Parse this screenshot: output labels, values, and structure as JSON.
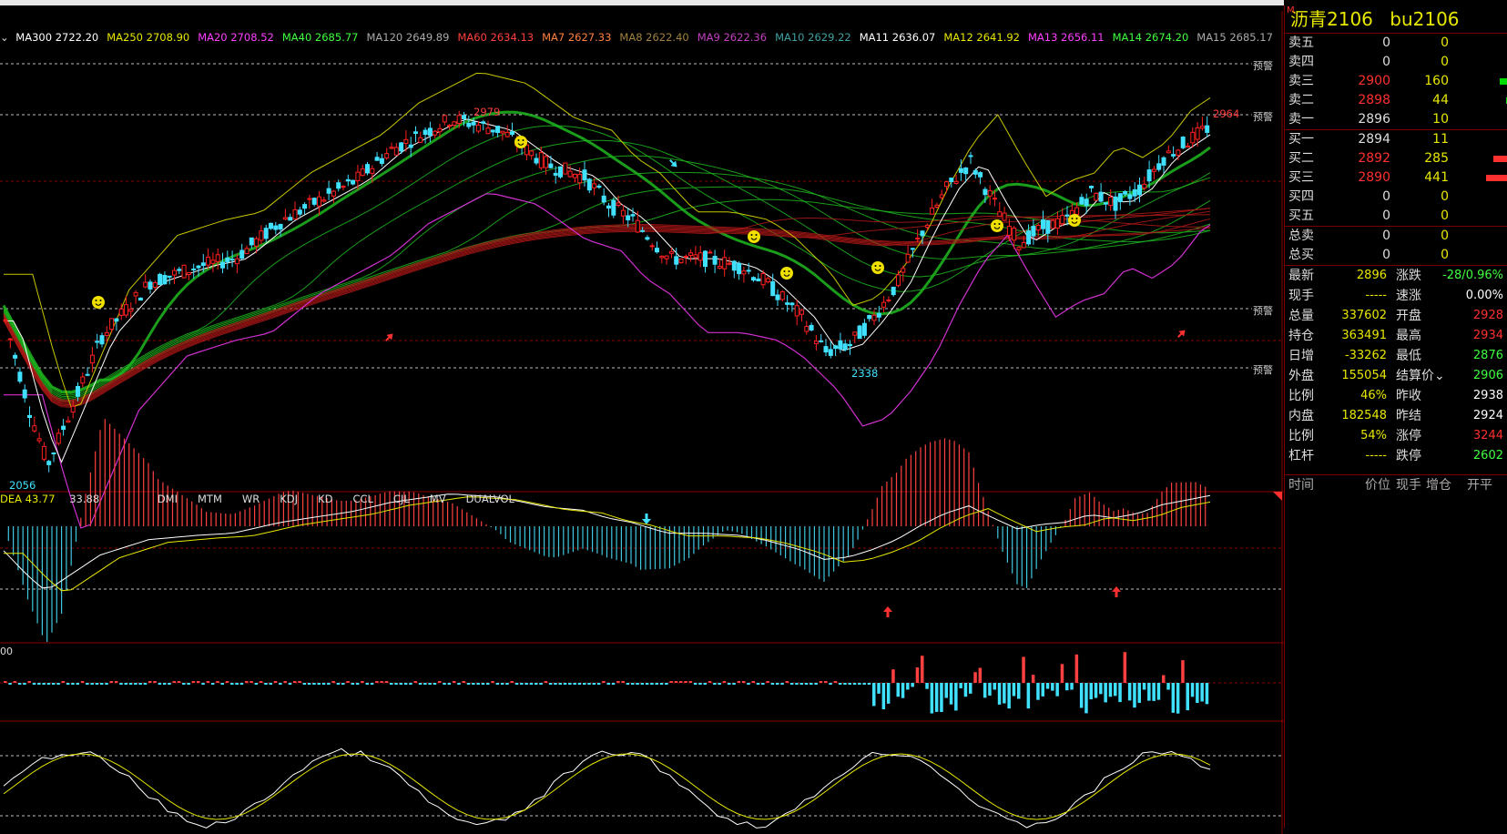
{
  "ma_bar": {
    "prefix": "⌄",
    "items": [
      {
        "label": "MA300 2722.20",
        "color": "#ffffff"
      },
      {
        "label": "MA250 2708.90",
        "color": "#e7e700"
      },
      {
        "label": "MA20 2708.52",
        "color": "#ff40ff"
      },
      {
        "label": "MA40 2685.77",
        "color": "#40ff40"
      },
      {
        "label": "MA120 2649.89",
        "color": "#aaaaaa"
      },
      {
        "label": "MA60 2634.13",
        "color": "#ff4040"
      },
      {
        "label": "MA7 2627.33",
        "color": "#ff8040"
      },
      {
        "label": "MA8 2622.40",
        "color": "#a08040"
      },
      {
        "label": "MA9 2622.36",
        "color": "#c040c0"
      },
      {
        "label": "MA10 2629.22",
        "color": "#40a0a0"
      },
      {
        "label": "MA11 2636.07",
        "color": "#ffffff"
      },
      {
        "label": "MA12 2641.92",
        "color": "#e7e700"
      },
      {
        "label": "MA13 2656.11",
        "color": "#ff40ff"
      },
      {
        "label": "MA14 2674.20",
        "color": "#40ff40"
      },
      {
        "label": "MA15 2685.17",
        "color": "#aaaaaa"
      }
    ]
  },
  "main_chart": {
    "high_label": "2979",
    "recent_high_label": "2964",
    "low_label": "2338",
    "bottom_label": "2056",
    "warn_label": "预警"
  },
  "indicator": {
    "dea_label": "DEA 43.77",
    "dea_value": "33.88",
    "tabs": [
      "DMI",
      "MTM",
      "WR",
      "KDJ",
      "KD",
      "CCL",
      "CJL",
      "MV",
      "DUALVOL"
    ],
    "vol_axis": "00"
  },
  "quote": {
    "title": "沥青2106",
    "code": "bu2106",
    "mark": "M",
    "sells": [
      {
        "name": "卖五",
        "price": "0",
        "vol": "0",
        "price_color": "#dddddd",
        "bar": 0
      },
      {
        "name": "卖四",
        "price": "0",
        "vol": "0",
        "price_color": "#dddddd",
        "bar": 0
      },
      {
        "name": "卖三",
        "price": "2900",
        "vol": "160",
        "price_color": "#ff3030",
        "bar": 160,
        "bar_color": "#00dd00"
      },
      {
        "name": "卖二",
        "price": "2898",
        "vol": "44",
        "price_color": "#ff3030",
        "bar": 44,
        "bar_color": "#00dd00"
      },
      {
        "name": "卖一",
        "price": "2896",
        "vol": "10",
        "price_color": "#dddddd",
        "bar": 0
      }
    ],
    "buys": [
      {
        "name": "买一",
        "price": "2894",
        "vol": "11",
        "price_color": "#dddddd",
        "bar": 0
      },
      {
        "name": "买二",
        "price": "2892",
        "vol": "285",
        "price_color": "#ff3030",
        "bar": 285,
        "bar_color": "#ff3030"
      },
      {
        "name": "买三",
        "price": "2890",
        "vol": "441",
        "price_color": "#ff3030",
        "bar": 441,
        "bar_color": "#ff3030"
      },
      {
        "name": "买四",
        "price": "0",
        "vol": "0",
        "price_color": "#dddddd",
        "bar": 0
      },
      {
        "name": "买五",
        "price": "0",
        "vol": "0",
        "price_color": "#dddddd",
        "bar": 0
      }
    ],
    "totals": [
      {
        "name": "总卖",
        "price": "0",
        "vol": "0"
      },
      {
        "name": "总买",
        "price": "0",
        "vol": "0"
      }
    ],
    "stats": [
      {
        "l1": "最新",
        "v1": "2896",
        "c1": "#e7e700",
        "l2": "涨跌",
        "v2": "-28/0.96%",
        "c2": "#40ff40"
      },
      {
        "l1": "现手",
        "v1": "-----",
        "c1": "#e7e700",
        "l2": "速涨",
        "v2": "0.00%",
        "c2": "#ffffff"
      },
      {
        "l1": "总量",
        "v1": "337602",
        "c1": "#e7e700",
        "l2": "开盘",
        "v2": "2928",
        "c2": "#ff3030"
      },
      {
        "l1": "持仓",
        "v1": "363491",
        "c1": "#e7e700",
        "l2": "最高",
        "v2": "2934",
        "c2": "#ff3030"
      },
      {
        "l1": "日增",
        "v1": "-33262",
        "c1": "#e7e700",
        "l2": "最低",
        "v2": "2876",
        "c2": "#40ff40"
      },
      {
        "l1": "外盘",
        "v1": "155054",
        "c1": "#e7e700",
        "l2": "结算价⌄",
        "v2": "2906",
        "c2": "#40ff40"
      },
      {
        "l1": "比例",
        "v1": "46%",
        "c1": "#e7e700",
        "l2": "昨收",
        "v2": "2938",
        "c2": "#ffffff"
      },
      {
        "l1": "内盘",
        "v1": "182548",
        "c1": "#e7e700",
        "l2": "昨结",
        "v2": "2924",
        "c2": "#ffffff"
      },
      {
        "l1": "比例",
        "v1": "54%",
        "c1": "#e7e700",
        "l2": "涨停",
        "v2": "3244",
        "c2": "#ff3030"
      },
      {
        "l1": "杠杆",
        "v1": "-----",
        "c1": "#e7e700",
        "l2": "跌停",
        "v2": "2602",
        "c2": "#40ff40"
      }
    ],
    "tick_headers": [
      "时间",
      "价位",
      "现手",
      "增仓",
      "开平"
    ]
  }
}
